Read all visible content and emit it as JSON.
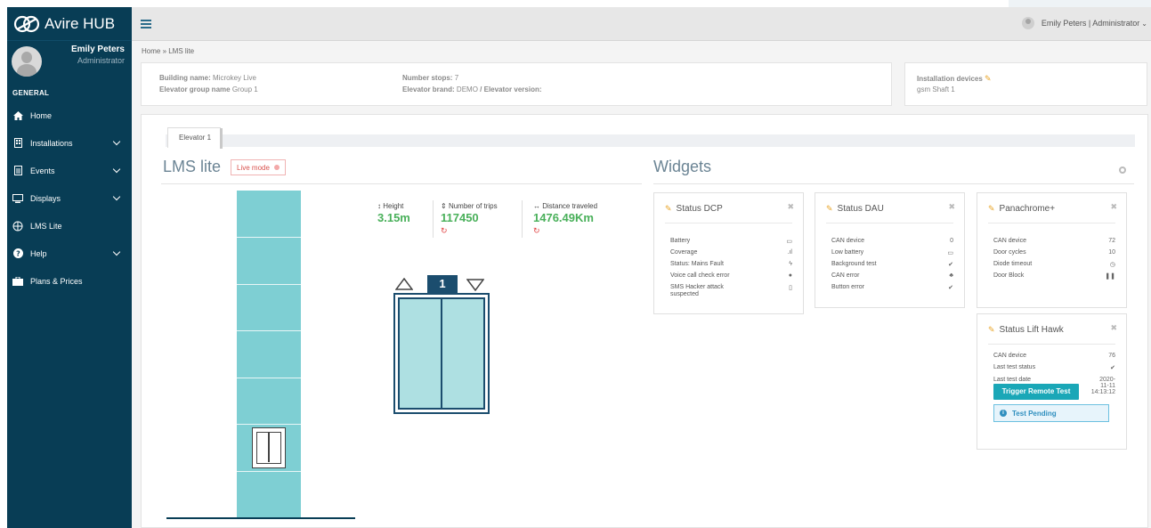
{
  "app": {
    "brand": "Avire HUB"
  },
  "profile": {
    "name": "Emily Peters",
    "role": "Administrator"
  },
  "sidebar": {
    "section": "GENERAL",
    "items": [
      {
        "label": "Home",
        "icon": "home-icon"
      },
      {
        "label": "Installations",
        "icon": "building-icon"
      },
      {
        "label": "Events",
        "icon": "document-icon"
      },
      {
        "label": "Displays",
        "icon": "monitor-icon"
      },
      {
        "label": "LMS Lite",
        "icon": "lms-logo-icon"
      },
      {
        "label": "Help",
        "icon": "question-icon"
      },
      {
        "label": "Plans & Prices",
        "icon": "briefcase-icon"
      }
    ]
  },
  "header": {
    "user": "Emily Peters | Administrator"
  },
  "breadcrumb": "Home » LMS lite",
  "building": {
    "name_label": "Building name:",
    "name": "Microkey Live",
    "group_label": "Elevator group name",
    "group": "Group 1",
    "stops_label": "Number stops:",
    "stops": "7",
    "brand_label": "Elevator brand:",
    "brand": "DEMO",
    "version_label": "/ Elevator version:"
  },
  "installation": {
    "title": "Installation devices",
    "device": "gsm",
    "shaft": "Shaft 1"
  },
  "tabs": [
    "Elevator 1"
  ],
  "lms": {
    "title": "LMS lite",
    "live_mode": "Live mode",
    "floors": 7,
    "current_floor": "1",
    "stats": [
      {
        "label": "Height",
        "value": "3.15m"
      },
      {
        "label": "Number of trips",
        "value": "117450",
        "refresh": "↻"
      },
      {
        "label": "Distance traveled",
        "value": "1476.49Km",
        "refresh": "↻"
      }
    ]
  },
  "widgets": {
    "title": "Widgets",
    "dcp": {
      "title": "Status DCP",
      "rows": [
        {
          "k": "Battery",
          "icon": "battery-icon"
        },
        {
          "k": "Coverage",
          "icon": "signal-icon"
        },
        {
          "k": "Status: Mains Fault",
          "icon": "bolt-icon"
        },
        {
          "k": "Voice call check error",
          "icon": "chat-icon"
        },
        {
          "k": "SMS Hacker attack suspected",
          "icon": "phone-icon"
        }
      ]
    },
    "dau": {
      "title": "Status DAU",
      "rows": [
        {
          "k": "CAN device",
          "v": "0"
        },
        {
          "k": "Low battery",
          "icon": "battery-icon"
        },
        {
          "k": "Background test",
          "icon": "check-circle-icon"
        },
        {
          "k": "CAN error",
          "icon": "network-icon"
        },
        {
          "k": "Button error",
          "icon": "check-circle-icon"
        }
      ]
    },
    "panachrome": {
      "title": "Panachrome+",
      "rows": [
        {
          "k": "CAN device",
          "v": "72"
        },
        {
          "k": "Door cycles",
          "v": "10"
        },
        {
          "k": "Diode timeout",
          "icon": "clock-icon"
        },
        {
          "k": "Door Block",
          "icon": "pause-icon"
        }
      ]
    },
    "lifthawk": {
      "title": "Status Lift Hawk",
      "rows": [
        {
          "k": "CAN device",
          "v": "76"
        },
        {
          "k": "Last test status",
          "icon": "check-circle-icon"
        },
        {
          "k": "Last test date",
          "v": "2020-\n11-11\n14:13:12"
        }
      ],
      "trigger": "Trigger Remote Test",
      "pending": "Test Pending"
    }
  },
  "colors": {
    "sidebar": "#083d55",
    "accent": "#1aa7b7",
    "green": "#49b05a",
    "red": "#d9534f",
    "shaft": "#7ecfd3"
  }
}
